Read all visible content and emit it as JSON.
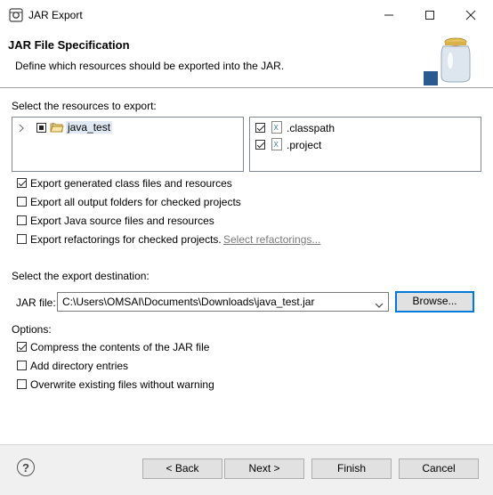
{
  "window": {
    "title": "JAR Export"
  },
  "header": {
    "title": "JAR File Specification",
    "description": "Define which resources should be exported into the JAR."
  },
  "resources": {
    "label": "Select the resources to export:",
    "tree": [
      {
        "label": "java_test",
        "state": "partial"
      }
    ],
    "files": [
      {
        "label": ".classpath",
        "checked": true
      },
      {
        "label": ".project",
        "checked": true
      }
    ]
  },
  "options_top": [
    {
      "label": "Export generated class files and resources",
      "checked": true
    },
    {
      "label": "Export all output folders for checked projects",
      "checked": false
    },
    {
      "label": "Export Java source files and resources",
      "checked": false
    },
    {
      "label": "Export refactorings for checked projects.",
      "checked": false
    }
  ],
  "select_refactorings_link": "Select refactorings...",
  "destination": {
    "label": "Select the export destination:",
    "jar_file_label": "JAR file:",
    "jar_file_value": "C:\\Users\\OMSAI\\Documents\\Downloads\\java_test.jar",
    "browse_label": "Browse..."
  },
  "options": {
    "label": "Options:",
    "items": [
      {
        "label": "Compress the contents of the JAR file",
        "checked": true
      },
      {
        "label": "Add directory entries",
        "checked": false
      },
      {
        "label": "Overwrite existing files without warning",
        "checked": false
      }
    ]
  },
  "footer": {
    "help": "?",
    "back": "< Back",
    "next": "Next >",
    "finish": "Finish",
    "cancel": "Cancel"
  }
}
